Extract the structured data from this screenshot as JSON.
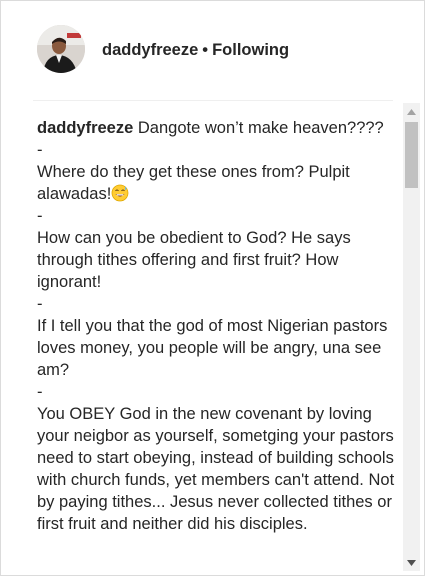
{
  "header": {
    "username": "daddyfreeze",
    "separator": "•",
    "follow_status": "Following"
  },
  "post": {
    "caption_username": "daddyfreeze",
    "lines": [
      "Dangote won’t make heaven????",
      "-",
      "Where do they get these ones from? Pulpit alawadas!",
      "-",
      "How can you be obedient to God? He says through tithes offering and first fruit? How ignorant!",
      "-",
      "If I tell you that the god of most Nigerian pastors loves money, you people will be angry, una see am?",
      "-",
      "You OBEY God in the new covenant by loving your neigbor as yourself, sometging your pastors need to start obeying, instead of building schools with church funds, yet members can't attend. Not by paying tithes... Jesus never collected tithes or first fruit and neither did his disciples."
    ],
    "emoji": "grinning-sweat-emoji"
  },
  "scrollbar": {
    "up_icon": "scroll-up-arrow-icon",
    "down_icon": "scroll-down-arrow-icon",
    "position": 0.0
  }
}
